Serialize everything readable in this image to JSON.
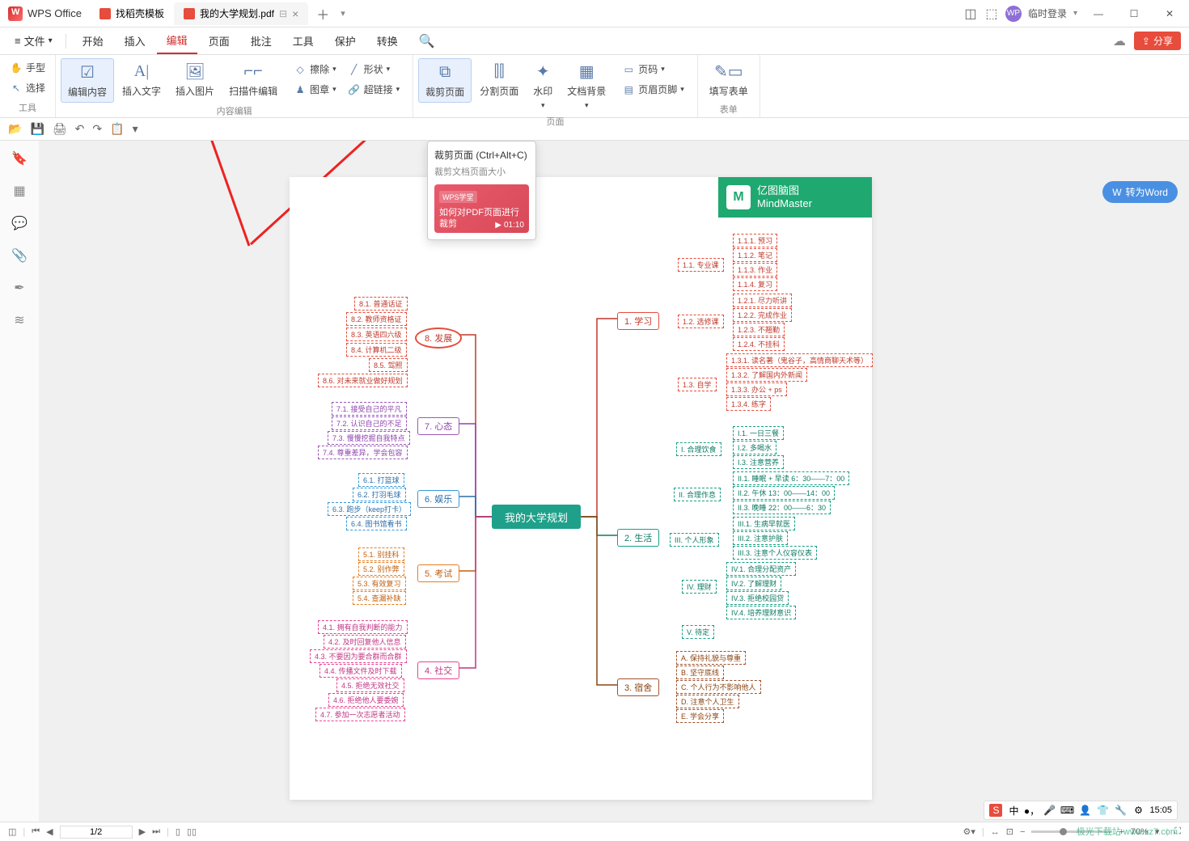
{
  "app": {
    "name": "WPS Office"
  },
  "tabs": [
    {
      "label": "找稻壳模板",
      "active": false
    },
    {
      "label": "我的大学规划.pdf",
      "active": true
    }
  ],
  "title_right": {
    "login": "临时登录"
  },
  "file_menu": "文件",
  "menus": [
    "开始",
    "插入",
    "编辑",
    "页面",
    "批注",
    "工具",
    "保护",
    "转换"
  ],
  "active_menu_index": 2,
  "ribbon": {
    "group_tools": {
      "hand": "手型",
      "select": "选择",
      "label": "工具"
    },
    "group_content": {
      "edit_content": "编辑内容",
      "insert_text": "插入文字",
      "insert_image": "插入图片",
      "scan_edit": "扫描件编辑",
      "erase": "擦除",
      "shape": "形状",
      "stamp": "图章",
      "hyperlink": "超链接",
      "label": "内容编辑"
    },
    "group_page": {
      "crop": "裁剪页面",
      "split": "分割页面",
      "watermark": "水印",
      "bg": "文档背景",
      "pagenum": "页码",
      "headerfooter": "页眉页脚",
      "label": "页面"
    },
    "group_form": {
      "fill_form": "填写表单",
      "label": "表单"
    }
  },
  "tooltip": {
    "title": "裁剪页面",
    "shortcut": "(Ctrl+Alt+C)",
    "sub": "裁剪文档页面大小",
    "card_tag": "WPS学堂",
    "card_text": "如何对PDF页面进行裁剪",
    "card_time": "01:10"
  },
  "convert_word": "转为Word",
  "mindmap": {
    "logo_cn": "亿图脑图",
    "logo_en": "MindMaster",
    "root": "我的大学规划",
    "left": {
      "b8": {
        "title": "8. 发展",
        "items": [
          "8.1. 普通话证",
          "8.2. 教师资格证",
          "8.3. 英语四六级",
          "8.4. 计算机二级",
          "8.5. 驾照",
          "8.6. 对未来就业做好规划"
        ]
      },
      "b7": {
        "title": "7. 心态",
        "items": [
          "7.1. 接受自己的平凡",
          "7.2. 认识自己的不足",
          "7.3. 慢慢挖掘自我特点",
          "7.4. 尊重差异，学会包容"
        ]
      },
      "b6": {
        "title": "6. 娱乐",
        "items": [
          "6.1. 打篮球",
          "6.2. 打羽毛球",
          "6.3. 跑步（keep打卡）",
          "6.4. 图书馆看书"
        ]
      },
      "b5": {
        "title": "5. 考试",
        "items": [
          "5.1. 别挂科",
          "5.2. 别作弊",
          "5.3. 有效复习",
          "5.4. 查漏补缺"
        ]
      },
      "b4": {
        "title": "4. 社交",
        "items": [
          "4.1. 拥有自我判断的能力",
          "4.2. 及时回复他人信息",
          "4.3. 不要因为要合群而合群",
          "4.4. 传播文件及时下载",
          "4.5. 拒绝无效社交",
          "4.6. 拒绝他人要委婉",
          "4.7. 参加一次志愿者活动"
        ]
      }
    },
    "right": {
      "b1": {
        "title": "1. 学习",
        "subs": [
          {
            "t": "1.1. 专业课",
            "items": [
              "1.1.1. 预习",
              "1.1.2. 笔记",
              "1.1.3. 作业",
              "1.1.4. 复习"
            ]
          },
          {
            "t": "1.2. 选修课",
            "items": [
              "1.2.1. 尽力听讲",
              "1.2.2. 完成作业",
              "1.2.3. 不翘勤",
              "1.2.4. 不挂科"
            ]
          },
          {
            "t": "1.3. 自学",
            "items": [
              "1.3.1. 读名著（鬼谷子，高情商聊天术等）",
              "1.3.2. 了解国内外新闻",
              "1.3.3. 办公 + ps",
              "1.3.4. 练字"
            ]
          }
        ]
      },
      "b2": {
        "title": "2. 生活",
        "subs": [
          {
            "t": "I. 合理饮食",
            "items": [
              "I.1. 一日三餐",
              "I.2. 多喝水",
              "I.3. 注意营养"
            ]
          },
          {
            "t": "II. 合理作息",
            "items": [
              "II.1. 睡眠 + 早读 6：30——7：00",
              "II.2. 午休 13：00——14：00",
              "II.3. 晚睡 22：00——6：30"
            ]
          },
          {
            "t": "III. 个人形象",
            "items": [
              "III.1. 生病早就医",
              "III.2. 注意护肤",
              "III.3. 注意个人仪容仪表"
            ]
          },
          {
            "t": "IV. 理财",
            "items": [
              "IV.1. 合理分配资产",
              "IV.2. 了解理财",
              "IV.3. 拒绝校园贷",
              "IV.4. 培养理财意识"
            ]
          },
          {
            "t": "V. 待定",
            "items": []
          }
        ]
      },
      "b3": {
        "title": "3. 宿舍",
        "items": [
          "A. 保持礼貌与尊重",
          "B. 坚守底线",
          "C. 个人行为不影响他人",
          "D. 注意个人卫生",
          "E. 学会分享"
        ]
      }
    }
  },
  "statusbar": {
    "page": "1/2",
    "zoom": "70%"
  },
  "tray_time": "15:05",
  "watermark": "极光下载站 www.xz7.com"
}
